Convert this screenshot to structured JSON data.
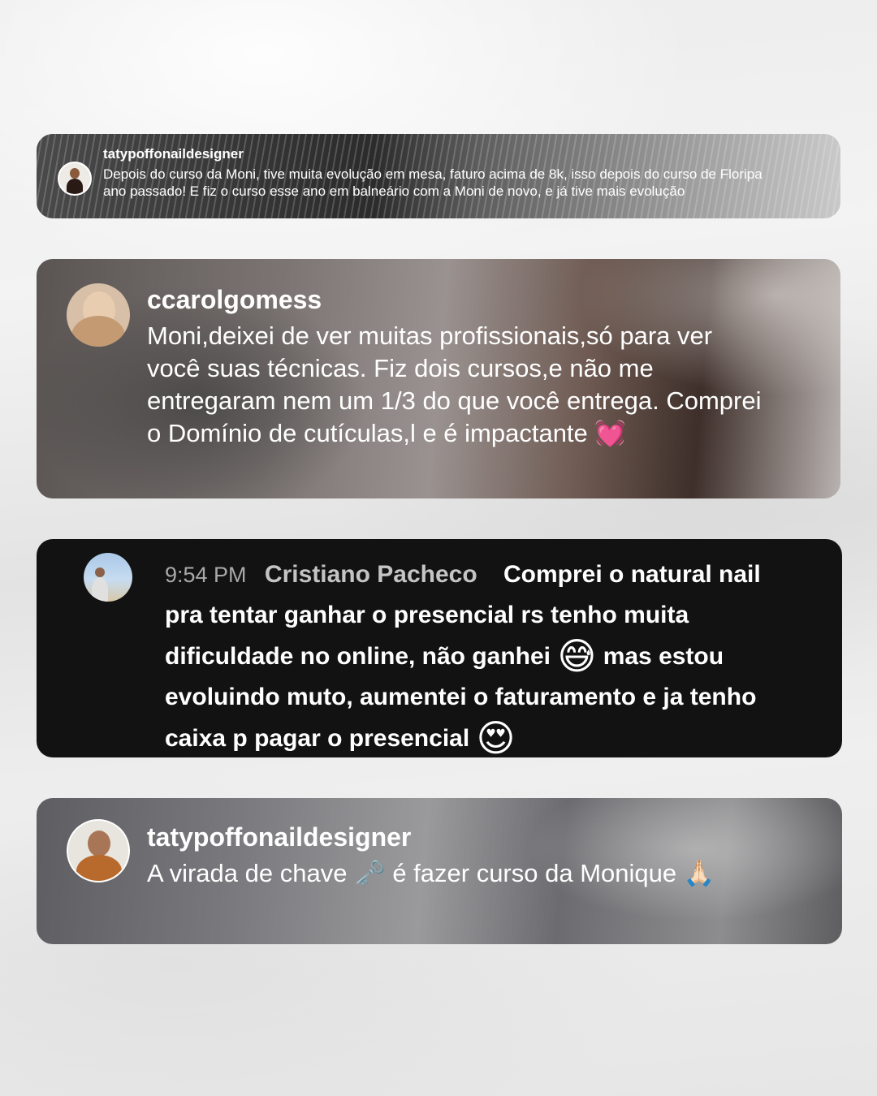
{
  "comments": [
    {
      "username": "tatypoffonaildesigner",
      "text": "Depois do curso da Moni, tive muita evolução em mesa, faturo acima de 8k, isso depois do curso de Floripa ano passado! E fiz o curso esse ano em balneário com a Moni de novo, e já tive mais evolução"
    },
    {
      "username": "ccarolgomess",
      "text": "Moni,deixei de ver muitas profissionais,só para ver você suas técnicas. Fiz dois cursos,e não me entregaram nem um 1/3 do que você entrega. Comprei o Domínio de cutículas,l e é impactante",
      "emoji": "💓"
    },
    {
      "time": "9:54 PM",
      "author": "Cristiano Pacheco",
      "text_a": "Comprei o natural nail pra tentar ganhar o presencial rs tenho muita dificuldade no online, não ganhei",
      "emoji_a": "😅",
      "text_b": "mas estou evoluindo muto, aumentei o faturamento e ja tenho caixa p pagar o presencial",
      "emoji_b": "😍"
    },
    {
      "username": "tatypoffonaildesigner",
      "text_a": "A virada de chave",
      "emoji_a": "🗝️",
      "text_b": "é fazer curso da Monique",
      "emoji_b": "🙏🏻"
    }
  ],
  "icons": {
    "avatar_1": "avatar-photo",
    "avatar_2": "avatar-photo",
    "avatar_3": "avatar-photo",
    "avatar_4": "avatar-photo"
  }
}
